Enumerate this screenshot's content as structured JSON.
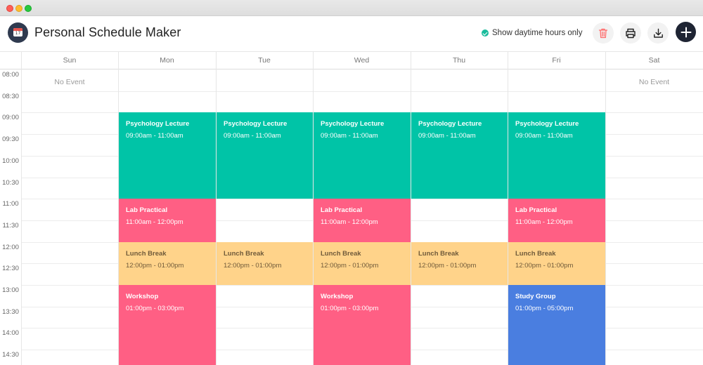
{
  "app": {
    "title": "Personal Schedule Maker"
  },
  "toolbar": {
    "show_daytime_label": "Show daytime hours only",
    "show_daytime_checked": true,
    "icons": [
      "trash-icon",
      "printer-icon",
      "download-icon",
      "plus-icon"
    ]
  },
  "colors": {
    "teal": "#00c4a7",
    "pink": "#ff5f84",
    "yellow": "#ffd38a",
    "blue": "#4a7ee0",
    "accent": "#1e2433"
  },
  "days": [
    "Sun",
    "Mon",
    "Tue",
    "Wed",
    "Thu",
    "Fri",
    "Sat"
  ],
  "times": [
    "08:00",
    "08:30",
    "09:00",
    "09:30",
    "10:00",
    "10:30",
    "11:00",
    "11:30",
    "12:00",
    "12:30",
    "13:00",
    "13:30",
    "14:00",
    "14:30"
  ],
  "no_event_label": "No Event",
  "no_event_days": [
    0,
    6
  ],
  "events": [
    {
      "day": 1,
      "span": 5,
      "start": "09:00",
      "end": "11:00",
      "name": "Psychology Lecture",
      "time": "09:00am - 11:00am",
      "color": "teal"
    },
    {
      "day": 1,
      "span": 1,
      "start": "11:00",
      "end": "12:00",
      "name": "Lab Practical",
      "time": "11:00am - 12:00pm",
      "color": "pink"
    },
    {
      "day": 3,
      "span": 1,
      "start": "11:00",
      "end": "12:00",
      "name": "Lab Practical",
      "time": "11:00am - 12:00pm",
      "color": "pink"
    },
    {
      "day": 5,
      "span": 1,
      "start": "11:00",
      "end": "12:00",
      "name": "Lab Practical",
      "time": "11:00am - 12:00pm",
      "color": "pink"
    },
    {
      "day": 1,
      "span": 5,
      "start": "12:00",
      "end": "13:00",
      "name": "Lunch Break",
      "time": "12:00pm - 01:00pm",
      "color": "yellow"
    },
    {
      "day": 1,
      "span": 1,
      "start": "13:00",
      "end": "15:00",
      "name": "Workshop",
      "time": "01:00pm - 03:00pm",
      "color": "pink"
    },
    {
      "day": 3,
      "span": 1,
      "start": "13:00",
      "end": "15:00",
      "name": "Workshop",
      "time": "01:00pm - 03:00pm",
      "color": "pink"
    },
    {
      "day": 5,
      "span": 1,
      "start": "13:00",
      "end": "17:00",
      "name": "Study Group",
      "time": "01:00pm - 05:00pm",
      "color": "blue"
    }
  ],
  "event_sub_labels": {
    "psych": [
      "Psychology Lecture",
      "09:00am - 11:00am"
    ],
    "lunch": [
      "Lunch Break",
      "12:00pm - 01:00pm"
    ]
  }
}
